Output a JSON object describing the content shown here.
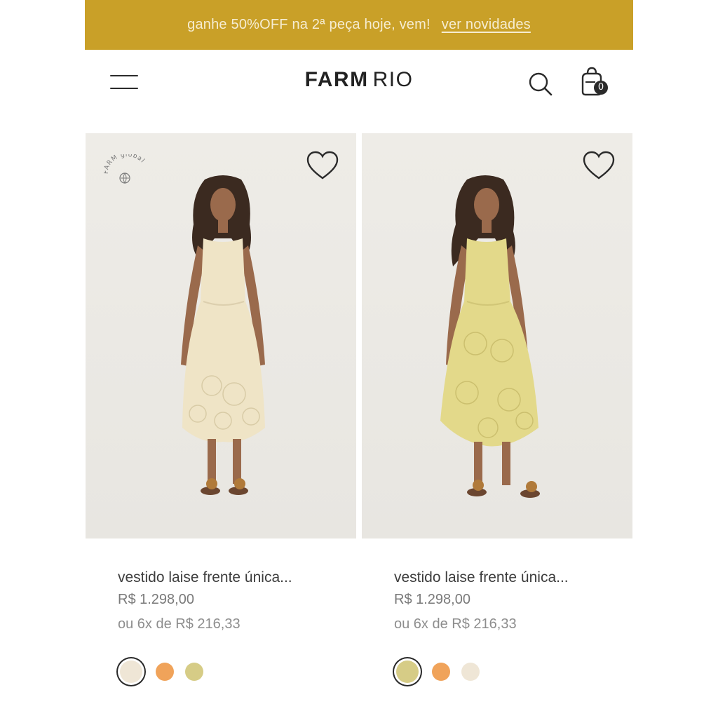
{
  "promo": {
    "text": "ganhe 50%OFF na 2ª peça hoje, vem!",
    "link": "ver novidades",
    "color": "#c9a028"
  },
  "header": {
    "brand_bold": "FARM",
    "brand_light": "RIO",
    "bag_count": "0",
    "icons": [
      "menu-icon",
      "search-icon",
      "shopping-bag-icon"
    ]
  },
  "products": [
    {
      "badge": "FARM global",
      "name": "vestido laise frente única...",
      "price": "R$ 1.298,00",
      "installments": "ou 6x de R$ 216,33",
      "dress_color": "#efe4c6",
      "swatches": [
        "#efe6d6",
        "#f0a35a",
        "#d6cc86"
      ],
      "selected_swatch": 0
    },
    {
      "badge": "",
      "name": "vestido laise frente única...",
      "price": "R$ 1.298,00",
      "installments": "ou 6x de R$ 216,33",
      "dress_color": "#e3d98a",
      "swatches": [
        "#d6cc86",
        "#f0a35a",
        "#efe6d6"
      ],
      "selected_swatch": 0
    }
  ]
}
